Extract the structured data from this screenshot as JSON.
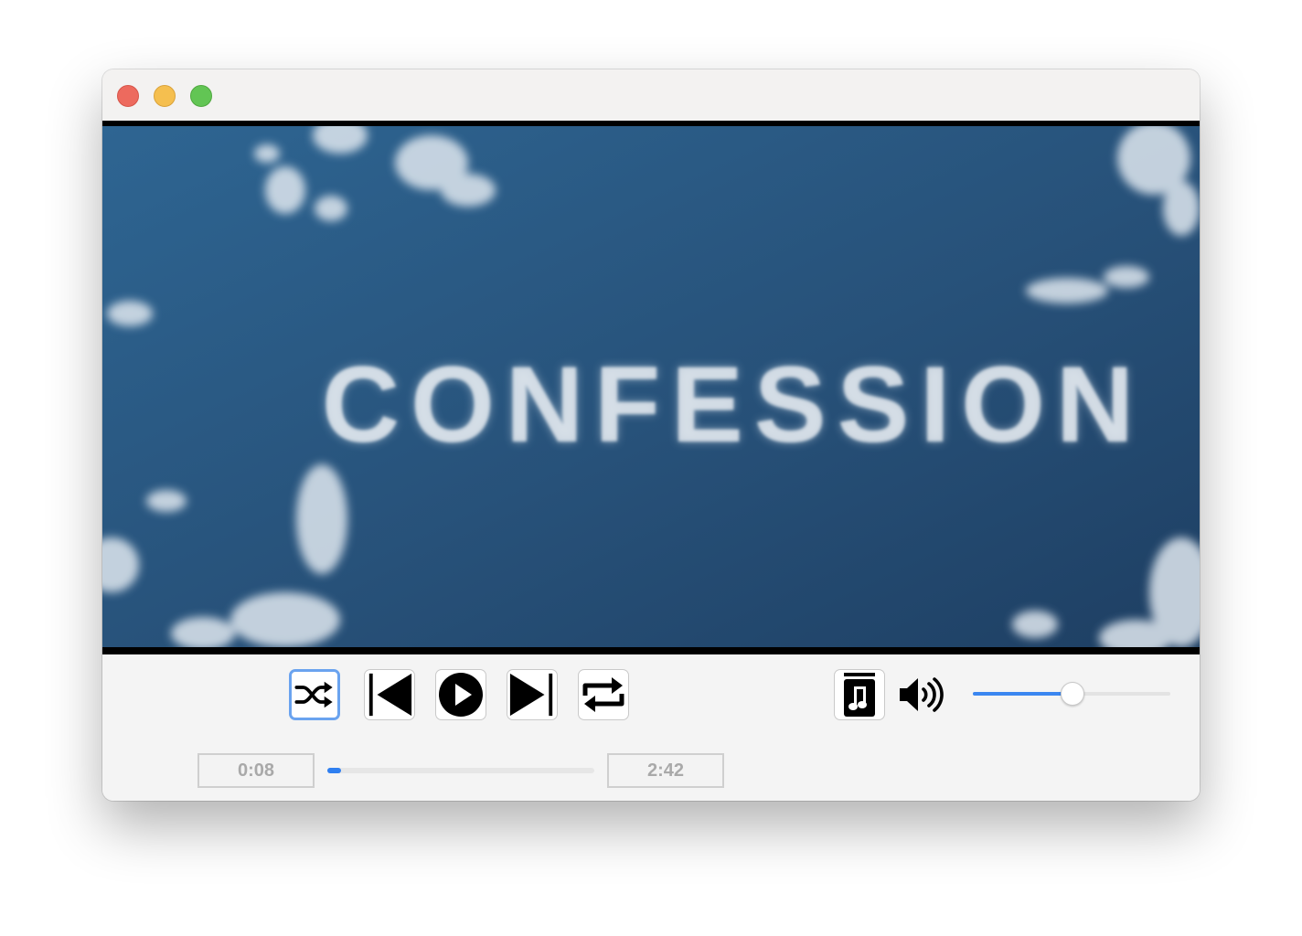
{
  "window": {
    "traffic_lights": [
      "close",
      "minimize",
      "zoom"
    ]
  },
  "video": {
    "title_text": "CONFESSION",
    "sky_color": "#2d5b82",
    "cloud_color": "#e6ecf2"
  },
  "controls": {
    "buttons": [
      {
        "name": "shuffle",
        "icon": "shuffle-icon",
        "focused": true
      },
      {
        "name": "previous",
        "icon": "previous-track-icon",
        "focused": false
      },
      {
        "name": "play",
        "icon": "play-icon",
        "focused": false
      },
      {
        "name": "next",
        "icon": "next-track-icon",
        "focused": false
      },
      {
        "name": "repeat",
        "icon": "repeat-icon",
        "focused": false
      },
      {
        "name": "music-library",
        "icon": "music-note-icon",
        "focused": false
      }
    ],
    "volume": {
      "icon": "speaker-volume-icon",
      "level": 0.5,
      "accent": "#3a86f0"
    },
    "seek": {
      "elapsed": "0:08",
      "duration": "2:42",
      "progress": 0.05,
      "accent": "#2f7ff0"
    }
  }
}
